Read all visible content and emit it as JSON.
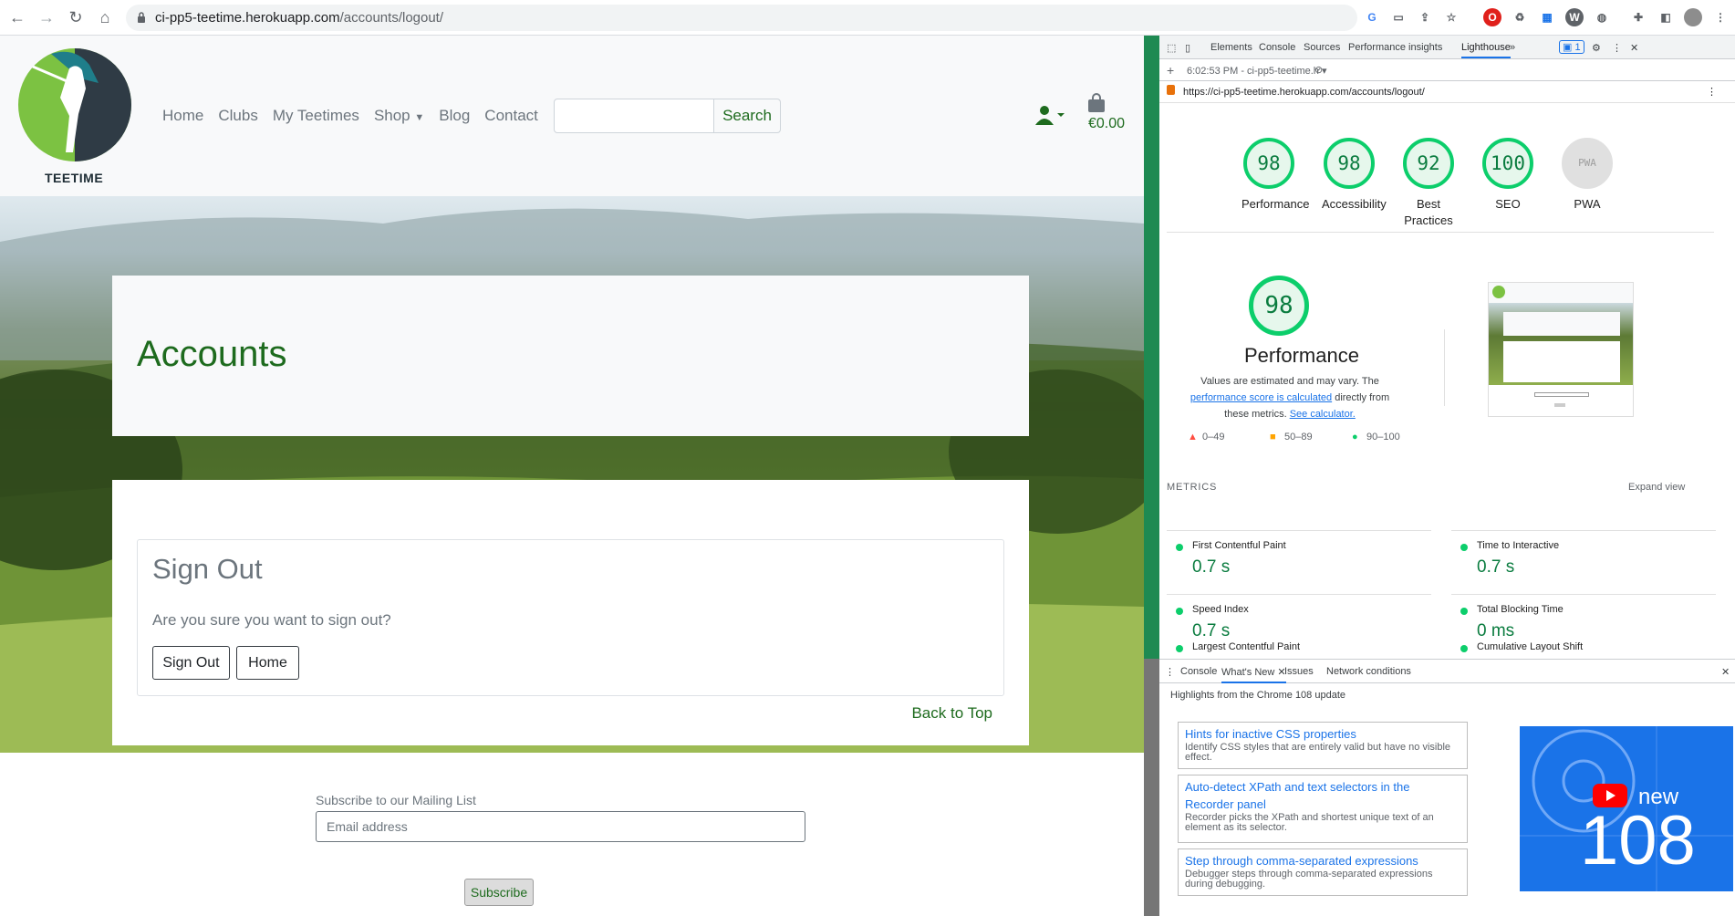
{
  "browser": {
    "url_host": "ci-pp5-teetime.herokuapp.com",
    "url_path": "/accounts/logout/"
  },
  "site": {
    "logo_text": "TEETIME",
    "nav": [
      "Home",
      "Clubs",
      "My Teetimes",
      "Shop",
      "Blog",
      "Contact"
    ],
    "search_button": "Search",
    "cart_total": "€0.00",
    "page_title": "Accounts",
    "signout": {
      "heading": "Sign Out",
      "question": "Are you sure you want to sign out?",
      "signout_button": "Sign Out",
      "home_button": "Home",
      "back_to_top": "Back to Top"
    },
    "footer": {
      "subscribe_label": "Subscribe to our Mailing List",
      "email_placeholder": "Email address",
      "subscribe_button": "Subscribe"
    }
  },
  "devtools": {
    "tabs": [
      "Elements",
      "Console",
      "Sources",
      "Performance insights",
      "Lighthouse"
    ],
    "active_tab": "Lighthouse",
    "issues_count": "1",
    "report_selector": "6:02:53 PM - ci-pp5-teetime.h",
    "report_url": "https://ci-pp5-teetime.herokuapp.com/accounts/logout/",
    "scores": [
      {
        "value": "98",
        "label": "Performance"
      },
      {
        "value": "98",
        "label": "Accessibility"
      },
      {
        "value": "92",
        "label": "Best Practices"
      },
      {
        "value": "100",
        "label": "SEO"
      },
      {
        "value": "PWA",
        "label": "PWA"
      }
    ],
    "perf_score": "98",
    "perf_title": "Performance",
    "perf_desc_1": "Values are estimated and may vary. The ",
    "perf_desc_link1": "performance score is calculated",
    "perf_desc_2": " directly from these metrics. ",
    "perf_desc_link2": "See calculator.",
    "legend": [
      "0–49",
      "50–89",
      "90–100"
    ],
    "metrics_label": "METRICS",
    "expand_view": "Expand view",
    "metrics": [
      {
        "name": "First Contentful Paint",
        "value": "0.7 s"
      },
      {
        "name": "Time to Interactive",
        "value": "0.7 s"
      },
      {
        "name": "Speed Index",
        "value": "0.7 s"
      },
      {
        "name": "Total Blocking Time",
        "value": "0 ms"
      },
      {
        "name": "Largest Contentful Paint",
        "value": ""
      },
      {
        "name": "Cumulative Layout Shift",
        "value": ""
      }
    ],
    "drawer_tabs": [
      "Console",
      "What's New",
      "Issues",
      "Network conditions"
    ],
    "drawer_subtitle": "Highlights from the Chrome 108 update",
    "whats_new": [
      {
        "title": "Hints for inactive CSS properties",
        "desc": "Identify CSS styles that are entirely valid but have no visible effect."
      },
      {
        "title": "Auto-detect XPath and text selectors in the Recorder panel",
        "desc": "Recorder picks the XPath and shortest unique text of an element as its selector."
      },
      {
        "title": "Step through comma-separated expressions",
        "desc": "Debugger steps through comma-separated expressions during debugging."
      }
    ],
    "banner_new": "new",
    "banner_version": "108"
  },
  "colors": {
    "brand_green": "#1e6b1e",
    "lighthouse_pass": "#0cce6b",
    "devtools_accent": "#1a73e8"
  }
}
